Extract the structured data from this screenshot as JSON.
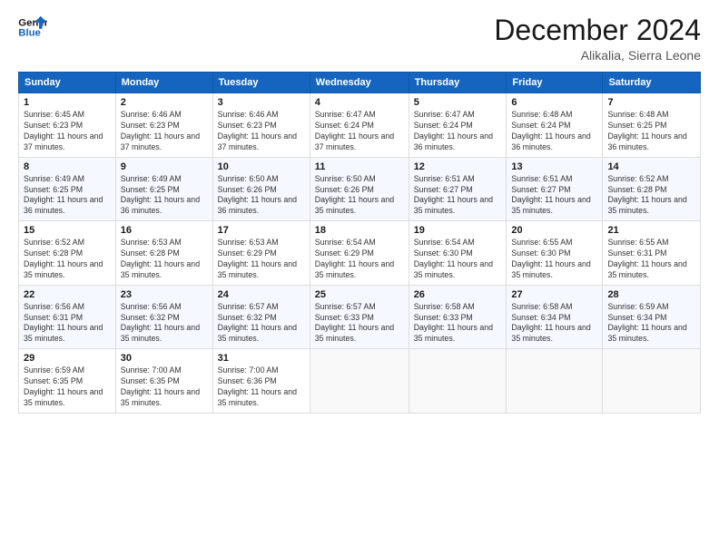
{
  "header": {
    "logo_line1": "General",
    "logo_line2": "Blue",
    "main_title": "December 2024",
    "subtitle": "Alikalia, Sierra Leone"
  },
  "columns": [
    "Sunday",
    "Monday",
    "Tuesday",
    "Wednesday",
    "Thursday",
    "Friday",
    "Saturday"
  ],
  "weeks": [
    [
      {
        "day": "1",
        "sunrise": "6:45 AM",
        "sunset": "6:23 PM",
        "daylight": "11 hours and 37 minutes."
      },
      {
        "day": "2",
        "sunrise": "6:46 AM",
        "sunset": "6:23 PM",
        "daylight": "11 hours and 37 minutes."
      },
      {
        "day": "3",
        "sunrise": "6:46 AM",
        "sunset": "6:23 PM",
        "daylight": "11 hours and 37 minutes."
      },
      {
        "day": "4",
        "sunrise": "6:47 AM",
        "sunset": "6:24 PM",
        "daylight": "11 hours and 37 minutes."
      },
      {
        "day": "5",
        "sunrise": "6:47 AM",
        "sunset": "6:24 PM",
        "daylight": "11 hours and 36 minutes."
      },
      {
        "day": "6",
        "sunrise": "6:48 AM",
        "sunset": "6:24 PM",
        "daylight": "11 hours and 36 minutes."
      },
      {
        "day": "7",
        "sunrise": "6:48 AM",
        "sunset": "6:25 PM",
        "daylight": "11 hours and 36 minutes."
      }
    ],
    [
      {
        "day": "8",
        "sunrise": "6:49 AM",
        "sunset": "6:25 PM",
        "daylight": "11 hours and 36 minutes."
      },
      {
        "day": "9",
        "sunrise": "6:49 AM",
        "sunset": "6:25 PM",
        "daylight": "11 hours and 36 minutes."
      },
      {
        "day": "10",
        "sunrise": "6:50 AM",
        "sunset": "6:26 PM",
        "daylight": "11 hours and 36 minutes."
      },
      {
        "day": "11",
        "sunrise": "6:50 AM",
        "sunset": "6:26 PM",
        "daylight": "11 hours and 35 minutes."
      },
      {
        "day": "12",
        "sunrise": "6:51 AM",
        "sunset": "6:27 PM",
        "daylight": "11 hours and 35 minutes."
      },
      {
        "day": "13",
        "sunrise": "6:51 AM",
        "sunset": "6:27 PM",
        "daylight": "11 hours and 35 minutes."
      },
      {
        "day": "14",
        "sunrise": "6:52 AM",
        "sunset": "6:28 PM",
        "daylight": "11 hours and 35 minutes."
      }
    ],
    [
      {
        "day": "15",
        "sunrise": "6:52 AM",
        "sunset": "6:28 PM",
        "daylight": "11 hours and 35 minutes."
      },
      {
        "day": "16",
        "sunrise": "6:53 AM",
        "sunset": "6:28 PM",
        "daylight": "11 hours and 35 minutes."
      },
      {
        "day": "17",
        "sunrise": "6:53 AM",
        "sunset": "6:29 PM",
        "daylight": "11 hours and 35 minutes."
      },
      {
        "day": "18",
        "sunrise": "6:54 AM",
        "sunset": "6:29 PM",
        "daylight": "11 hours and 35 minutes."
      },
      {
        "day": "19",
        "sunrise": "6:54 AM",
        "sunset": "6:30 PM",
        "daylight": "11 hours and 35 minutes."
      },
      {
        "day": "20",
        "sunrise": "6:55 AM",
        "sunset": "6:30 PM",
        "daylight": "11 hours and 35 minutes."
      },
      {
        "day": "21",
        "sunrise": "6:55 AM",
        "sunset": "6:31 PM",
        "daylight": "11 hours and 35 minutes."
      }
    ],
    [
      {
        "day": "22",
        "sunrise": "6:56 AM",
        "sunset": "6:31 PM",
        "daylight": "11 hours and 35 minutes."
      },
      {
        "day": "23",
        "sunrise": "6:56 AM",
        "sunset": "6:32 PM",
        "daylight": "11 hours and 35 minutes."
      },
      {
        "day": "24",
        "sunrise": "6:57 AM",
        "sunset": "6:32 PM",
        "daylight": "11 hours and 35 minutes."
      },
      {
        "day": "25",
        "sunrise": "6:57 AM",
        "sunset": "6:33 PM",
        "daylight": "11 hours and 35 minutes."
      },
      {
        "day": "26",
        "sunrise": "6:58 AM",
        "sunset": "6:33 PM",
        "daylight": "11 hours and 35 minutes."
      },
      {
        "day": "27",
        "sunrise": "6:58 AM",
        "sunset": "6:34 PM",
        "daylight": "11 hours and 35 minutes."
      },
      {
        "day": "28",
        "sunrise": "6:59 AM",
        "sunset": "6:34 PM",
        "daylight": "11 hours and 35 minutes."
      }
    ],
    [
      {
        "day": "29",
        "sunrise": "6:59 AM",
        "sunset": "6:35 PM",
        "daylight": "11 hours and 35 minutes."
      },
      {
        "day": "30",
        "sunrise": "7:00 AM",
        "sunset": "6:35 PM",
        "daylight": "11 hours and 35 minutes."
      },
      {
        "day": "31",
        "sunrise": "7:00 AM",
        "sunset": "6:36 PM",
        "daylight": "11 hours and 35 minutes."
      },
      null,
      null,
      null,
      null
    ]
  ]
}
